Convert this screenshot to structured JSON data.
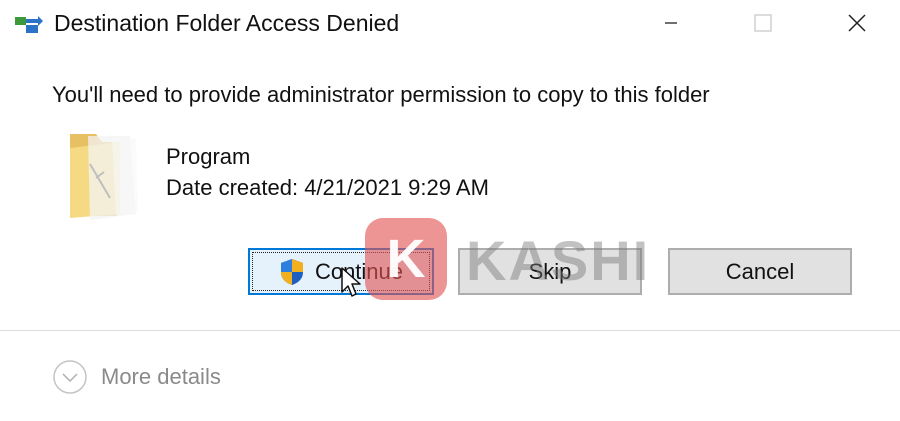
{
  "window": {
    "title": "Destination Folder Access Denied",
    "minimize_icon": "minimize-icon",
    "maximize_icon": "maximize-icon",
    "close_icon": "close-icon"
  },
  "message": "You'll need to provide administrator permission to copy to this folder",
  "item": {
    "icon": "folder-icon",
    "name": "Program",
    "date_created": "Date created: 4/21/2021 9:29 AM"
  },
  "buttons": {
    "continue_label": "Continue",
    "continue_icon": "uac-shield-icon",
    "skip_label": "Skip",
    "cancel_label": "Cancel"
  },
  "footer": {
    "more_details": "More details",
    "icon": "chevron-down-circle-icon"
  },
  "watermark": {
    "badge": "K",
    "text": "KASHI"
  },
  "colors": {
    "accent_border": "#0078d7",
    "button_bg": "#e1e1e1",
    "disabled_text": "#8a8a8a"
  }
}
